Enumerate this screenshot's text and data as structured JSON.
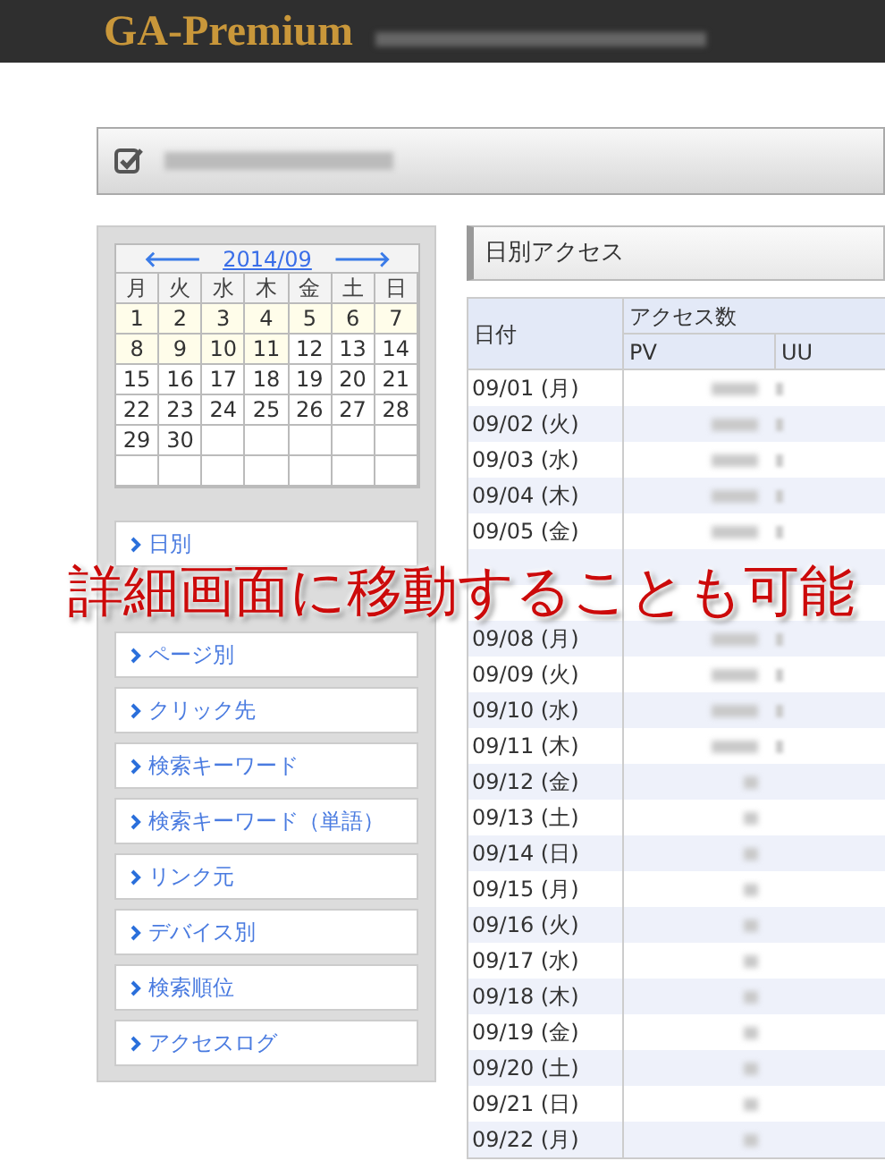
{
  "header": {
    "logo": "GA-Premium"
  },
  "calendar": {
    "prev": "🡐",
    "month": "2014/09",
    "next": "🡒",
    "weekdays": [
      "月",
      "火",
      "水",
      "木",
      "金",
      "土",
      "日"
    ],
    "days": [
      {
        "day": "1",
        "highlighted": true
      },
      {
        "day": "2",
        "highlighted": true
      },
      {
        "day": "3",
        "highlighted": true
      },
      {
        "day": "4",
        "highlighted": true
      },
      {
        "day": "5",
        "highlighted": true
      },
      {
        "day": "6",
        "highlighted": true
      },
      {
        "day": "7",
        "highlighted": true
      },
      {
        "day": "8",
        "highlighted": true
      },
      {
        "day": "9",
        "highlighted": true
      },
      {
        "day": "10",
        "highlighted": true
      },
      {
        "day": "11",
        "highlighted": true
      },
      {
        "day": "12",
        "highlighted": false
      },
      {
        "day": "13",
        "highlighted": false
      },
      {
        "day": "14",
        "highlighted": false
      },
      {
        "day": "15",
        "highlighted": false
      },
      {
        "day": "16",
        "highlighted": false
      },
      {
        "day": "17",
        "highlighted": false
      },
      {
        "day": "18",
        "highlighted": false
      },
      {
        "day": "19",
        "highlighted": false
      },
      {
        "day": "20",
        "highlighted": false
      },
      {
        "day": "21",
        "highlighted": false
      },
      {
        "day": "22",
        "highlighted": false
      },
      {
        "day": "23",
        "highlighted": false
      },
      {
        "day": "24",
        "highlighted": false
      },
      {
        "day": "25",
        "highlighted": false
      },
      {
        "day": "26",
        "highlighted": false
      },
      {
        "day": "27",
        "highlighted": false
      },
      {
        "day": "28",
        "highlighted": false
      },
      {
        "day": "29",
        "highlighted": false
      },
      {
        "day": "30",
        "highlighted": false
      }
    ]
  },
  "menu": [
    "日別",
    "ページ別",
    "クリック先",
    "検索キーワード",
    "検索キーワード（単語）",
    "リンク元",
    "デバイス別",
    "検索順位",
    "アクセスログ"
  ],
  "section_title": "日別アクセス",
  "table": {
    "columns": {
      "date": "日付",
      "group": "アクセス数",
      "pv": "PV",
      "uu": "UU"
    },
    "rows": [
      {
        "date": "09/01 (月)",
        "kind": "long"
      },
      {
        "date": "09/02 (火)",
        "kind": "long"
      },
      {
        "date": "09/03 (水)",
        "kind": "long"
      },
      {
        "date": "09/04 (木)",
        "kind": "long"
      },
      {
        "date": "09/05 (金)",
        "kind": "long"
      },
      {
        "date": "09/08 (月)",
        "kind": "long"
      },
      {
        "date": "09/09 (火)",
        "kind": "long"
      },
      {
        "date": "09/10 (水)",
        "kind": "long"
      },
      {
        "date": "09/11 (木)",
        "kind": "long"
      },
      {
        "date": "09/12 (金)",
        "kind": "short"
      },
      {
        "date": "09/13 (土)",
        "kind": "short"
      },
      {
        "date": "09/14 (日)",
        "kind": "short"
      },
      {
        "date": "09/15 (月)",
        "kind": "short"
      },
      {
        "date": "09/16 (火)",
        "kind": "short"
      },
      {
        "date": "09/17 (水)",
        "kind": "short"
      },
      {
        "date": "09/18 (木)",
        "kind": "short"
      },
      {
        "date": "09/19 (金)",
        "kind": "short"
      },
      {
        "date": "09/20 (土)",
        "kind": "short"
      },
      {
        "date": "09/21 (日)",
        "kind": "short"
      },
      {
        "date": "09/22 (月)",
        "kind": "short"
      }
    ]
  },
  "caption": "詳細画面に移動することも可能"
}
